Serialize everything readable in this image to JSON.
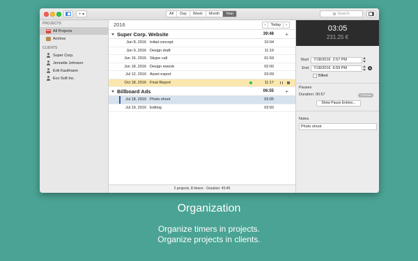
{
  "toolbar": {
    "range_tabs": [
      "All",
      "Day",
      "Week",
      "Month",
      "Year"
    ],
    "active_tab": "Year",
    "add_button": "+ ▾",
    "search_placeholder": "Search"
  },
  "sidebar": {
    "projects_header": "PROJECTS",
    "projects": [
      {
        "label": "All Projects",
        "icon": "projects-icon",
        "selected": true
      },
      {
        "label": "Archive",
        "icon": "archive-icon",
        "selected": false
      }
    ],
    "clients_header": "CLIENTS",
    "clients": [
      "Super Corp.",
      "Jennette Johnson",
      "Erik Kaufmann",
      "Eco Soft Inc."
    ]
  },
  "main": {
    "year": "2016",
    "nav": {
      "prev": "‹",
      "today": "Today",
      "next": "›"
    },
    "groups": [
      {
        "name": "Super Corp. Website",
        "duration": "39:48",
        "add": "+",
        "rows": [
          {
            "date": "Jun 8, 2016",
            "description": "Initial concept",
            "duration": "10:04"
          },
          {
            "date": "Jun 9, 2016",
            "description": "Design draft",
            "duration": "11:19"
          },
          {
            "date": "Jun 16, 2016",
            "description": "Skype call",
            "duration": "01:59"
          },
          {
            "date": "Jun 18, 2016",
            "description": "Design rework",
            "duration": "02:00"
          },
          {
            "date": "Jul 12, 2016",
            "description": "Asset export",
            "duration": "03:09"
          },
          {
            "date": "Oct 18, 2016",
            "description": "Final Report",
            "duration": "11:17",
            "state": "running"
          }
        ]
      },
      {
        "name": "Billboard Ads",
        "duration": "06:55",
        "add": "+",
        "rows": [
          {
            "date": "Jul 18, 2016",
            "description": "Photo shoot",
            "duration": "03:05",
            "state": "selected"
          },
          {
            "date": "Jul 19, 2016",
            "description": "Editing",
            "duration": "03:50"
          }
        ]
      }
    ],
    "status": "2 projects, 8 timers  ·  Duration: 45:45"
  },
  "inspector": {
    "time": "03:05",
    "amount": "231.25 €",
    "start_label": "Start",
    "start_date": "7/18/2016",
    "start_time": "2:57 PM",
    "end_label": "End",
    "end_date": "7/18/2016",
    "end_time": "6:59 PM",
    "billed_label": "Billed",
    "pauses_label": "Pauses",
    "pause_duration": "Duration: 00:57",
    "entries_badge": "2 Entries",
    "show_pauses_button": "Show Pause Entries...",
    "notes_label": "Notes",
    "notes_value": "Photo shoot"
  },
  "caption": {
    "title": "Organization",
    "line1": "Organize timers in projects.",
    "line2": "Organize projects in clients."
  }
}
